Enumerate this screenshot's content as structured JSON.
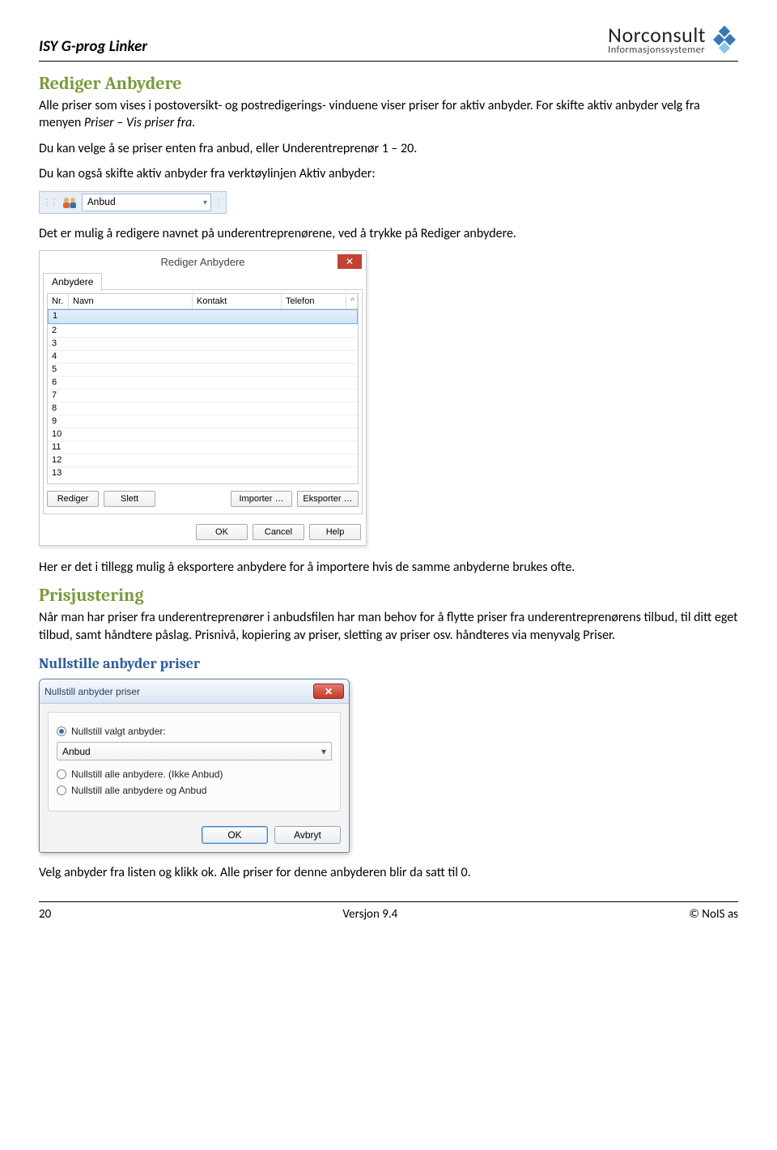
{
  "header": {
    "title": "ISY G-prog Linker"
  },
  "logo": {
    "brand": "Norconsult",
    "sub": "Informasjonssystemer"
  },
  "section1": {
    "heading": "Rediger Anbydere",
    "p1a": "Alle priser som vises i postoversikt- og postredigerings- vinduene viser priser for aktiv anbyder. For skifte aktiv anbyder velg fra menyen ",
    "p1b": "Priser – Vis priser fra.",
    "p2": "Du kan velge å se priser enten fra anbud, eller Underentreprenør 1 – 20.",
    "p3": "Du kan også skifte aktiv anbyder fra verktøylinjen Aktiv anbyder:",
    "p4": "Det er mulig å redigere navnet på underentreprenørene, ved å trykke på Rediger anbydere.",
    "p5": "Her er det i tillegg mulig å eksportere anbydere for å importere hvis de samme anbyderne brukes ofte."
  },
  "toolbar": {
    "selected": "Anbud"
  },
  "dialog1": {
    "title": "Rediger Anbydere",
    "tab": "Anbydere",
    "cols": {
      "nr": "Nr.",
      "navn": "Navn",
      "kontakt": "Kontakt",
      "telefon": "Telefon"
    },
    "rows": [
      "1",
      "2",
      "3",
      "4",
      "5",
      "6",
      "7",
      "8",
      "9",
      "10",
      "11",
      "12",
      "13"
    ],
    "btn_rediger": "Rediger",
    "btn_slett": "Slett",
    "btn_importer": "Importer …",
    "btn_eksporter": "Eksporter …",
    "btn_ok": "OK",
    "btn_cancel": "Cancel",
    "btn_help": "Help"
  },
  "section2": {
    "heading": "Prisjustering",
    "p1": "Når man har priser fra underentreprenører i anbudsfilen har man behov for å flytte priser fra underentreprenørens tilbud, til ditt eget tilbud, samt håndtere påslag. Prisnivå, kopiering av priser, sletting av priser osv. håndteres via menyvalg Priser.",
    "sub": "Nullstille anbyder priser"
  },
  "dialog2": {
    "title": "Nullstill anbyder priser",
    "opt1": "Nullstill valgt anbyder:",
    "combo": "Anbud",
    "opt2": "Nullstill alle anbydere. (Ikke Anbud)",
    "opt3": "Nullstill alle anbydere og Anbud",
    "btn_ok": "OK",
    "btn_cancel": "Avbryt"
  },
  "closing": "Velg anbyder fra listen og klikk ok. Alle priser for denne anbyderen blir da satt til 0.",
  "footer": {
    "page": "20",
    "version": "Versjon 9.4",
    "copyright": "© NoIS as"
  }
}
